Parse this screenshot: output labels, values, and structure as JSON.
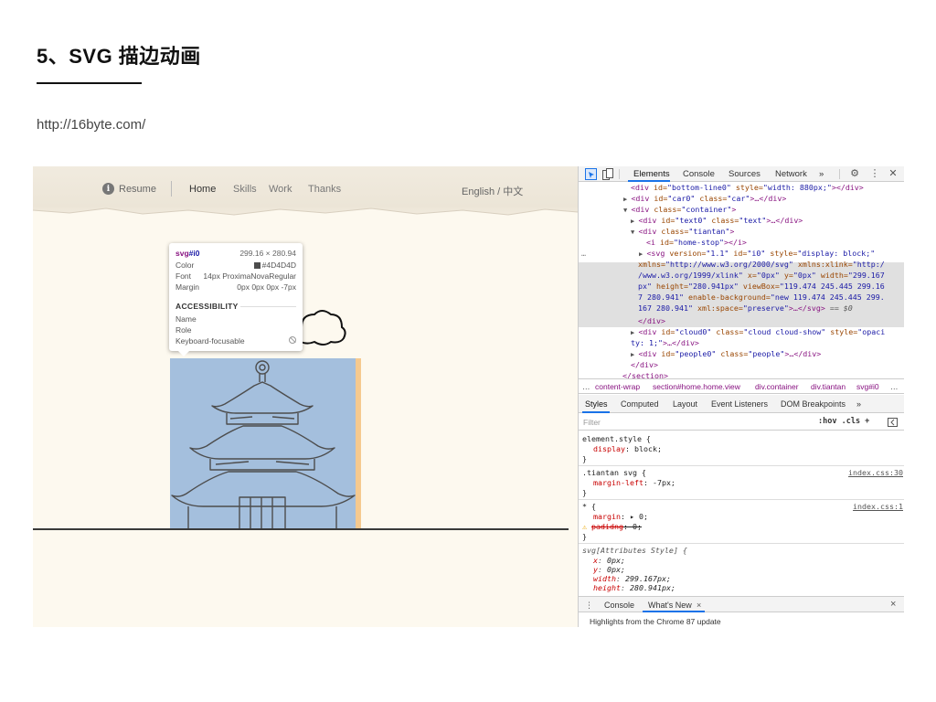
{
  "slide": {
    "title": "5、SVG 描边动画",
    "url": "http://16byte.com/"
  },
  "site": {
    "nav": {
      "resume": "Resume",
      "home": "Home",
      "skills": "Skills",
      "work": "Work",
      "thanks": "Thanks",
      "language": "English / 中文"
    },
    "tooltip": {
      "tag": "svg",
      "id": "#i0",
      "dimensions": "299.16 × 280.94",
      "rows": [
        {
          "label": "Color",
          "value": "#4D4D4D"
        },
        {
          "label": "Font",
          "value": "14px ProximaNovaRegular"
        },
        {
          "label": "Margin",
          "value": "0px 0px 0px -7px"
        }
      ],
      "section_heading": "ACCESSIBILITY",
      "a11y": [
        {
          "label": "Name",
          "value": ""
        },
        {
          "label": "Role",
          "value": ""
        },
        {
          "label": "Keyboard-focusable",
          "value": ""
        }
      ]
    }
  },
  "devtools": {
    "toolbar": {
      "tabs": [
        "Elements",
        "Console",
        "Sources",
        "Network"
      ],
      "more": "»"
    },
    "elements": {
      "line0": {
        "open": "<div ",
        "a1": "id=",
        "v1": "\"bottom-line0\"",
        "a2": " style=",
        "v2": "\"width: 880px;\"",
        "close": "></div>"
      },
      "line1": {
        "open": "<div ",
        "a1": "id=",
        "v1": "\"car0\"",
        "a2": " class=",
        "v2": "\"car\"",
        "close": ">…</div>"
      },
      "line2": {
        "open": "<div ",
        "a1": "class=",
        "v1": "\"container\"",
        "close": ">"
      },
      "line3": {
        "open": "<div ",
        "a1": "id=",
        "v1": "\"text0\"",
        "a2": " class=",
        "v2": "\"text\"",
        "close": ">…</div>"
      },
      "line4": {
        "open": "<div ",
        "a1": "class=",
        "v1": "\"tiantan\"",
        "close": ">"
      },
      "line5": {
        "open": "<i ",
        "a1": "id=",
        "v1": "\"home-stop\"",
        "close": "></i>"
      },
      "sel1": {
        "open": "<svg ",
        "a1": "version=",
        "v1": "\"1.1\"",
        "a2": " id=",
        "v2": "\"i0\"",
        "a3": " style=",
        "v3": "\"display: block;\""
      },
      "sel2": {
        "a1": "xmlns=",
        "v1": "\"http://www.w3.org/2000/svg\"",
        "a2": " xmlns:xlink=",
        "v2": "\"http:/"
      },
      "sel3": {
        "v1": "/www.w3.org/1999/xlink\"",
        "a2": " x=",
        "v2": "\"0px\"",
        "a3": " y=",
        "v3": "\"0px\"",
        "a4": " width=",
        "v4": "\"299.167"
      },
      "sel4": {
        "v1": "px\"",
        "a2": " height=",
        "v2": "\"280.941px\"",
        "a3": " viewBox=",
        "v3": "\"119.474 245.445 299.16"
      },
      "sel5": {
        "v1": "7 280.941\"",
        "a2": " enable-background=",
        "v2": "\"new 119.474 245.445 299."
      },
      "sel6": {
        "v1": "167 280.941\"",
        "a2": " xml:space=",
        "v2": "\"preserve\"",
        "close": ">…</svg>",
        "eq": " == $0"
      },
      "line6": {
        "close": "</div>"
      },
      "line7": {
        "open": "<div ",
        "a1": "id=",
        "v1": "\"cloud0\"",
        "a2": " class=",
        "v2": "\"cloud cloud-show\"",
        "a3": " style=",
        "v3": "\"opaci"
      },
      "line8": {
        "v1": "ty: 1;\"",
        "close": ">…</div>"
      },
      "line9": {
        "open": "<div ",
        "a1": "id=",
        "v1": "\"people0\"",
        "a2": " class=",
        "v2": "\"people\"",
        "close": ">…</div>"
      },
      "line10": {
        "close": "</div>"
      },
      "line11": {
        "close": "</section>"
      }
    },
    "breadcrumbs": [
      "…",
      "content-wrap",
      "section#home.home.view",
      "div.container",
      "div.tiantan",
      "svg#i0",
      "…"
    ],
    "sub_tabs": [
      "Styles",
      "Computed",
      "Layout",
      "Event Listeners",
      "DOM Breakpoints",
      "»"
    ],
    "filter": {
      "placeholder": "Filter",
      "options": ":hov  .cls  +"
    },
    "styles": {
      "element_style": "element.style {",
      "element_prop": "display",
      "element_val": "block;",
      "tiantan_sel": ".tiantan svg {",
      "tiantan_src": "index.css:30",
      "tiantan_prop": "margin-left",
      "tiantan_val": "-7px;",
      "star_sel": "* {",
      "star_src": "index.css:1",
      "star_prop1": "margin",
      "star_val1": "▸ 0;",
      "star_prop2": "padidng",
      "star_val2": "0;",
      "attr_sel": "svg[Attributes Style] {",
      "attr_x": "x",
      "attr_x_val": "0px;",
      "attr_y": "y",
      "attr_y_val": "0px;",
      "attr_w": "width",
      "attr_w_val": "299.167px;",
      "attr_h": "height",
      "attr_h_val": "280.941px;",
      "close_brace": "}"
    },
    "drawer": {
      "tabs": [
        "Console",
        "What's New"
      ],
      "close": "×",
      "highlight": "Highlights from the Chrome 87 update"
    }
  },
  "colors": {
    "highlight_blue": "#a4bfdd",
    "margin_orange": "#f5c98f",
    "tag_purple": "#881280",
    "attr_brown": "#994500",
    "value_blue": "#1a1aa6",
    "active_tab": "#1a73e8"
  }
}
